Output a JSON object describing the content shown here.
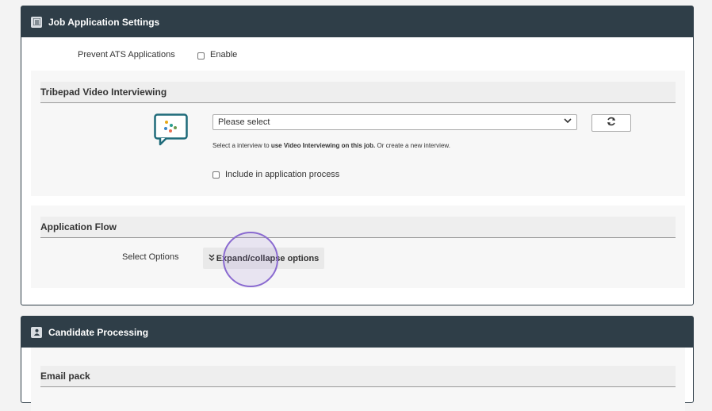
{
  "job_settings": {
    "title": "Job Application Settings",
    "prevent_label": "Prevent ATS Applications",
    "enable_label": "Enable"
  },
  "video": {
    "title": "Tribepad Video Interviewing",
    "select_value": "Please select",
    "help_pre": "Select a interview to ",
    "help_bold": "use Video Interviewing on this job.",
    "help_post": " Or create a new interview.",
    "include_label": "Include in application process"
  },
  "flow": {
    "title": "Application Flow",
    "select_label": "Select Options",
    "expand_label": "Expand/collapse options"
  },
  "candidate": {
    "title": "Candidate Processing",
    "email_title": "Email pack"
  }
}
